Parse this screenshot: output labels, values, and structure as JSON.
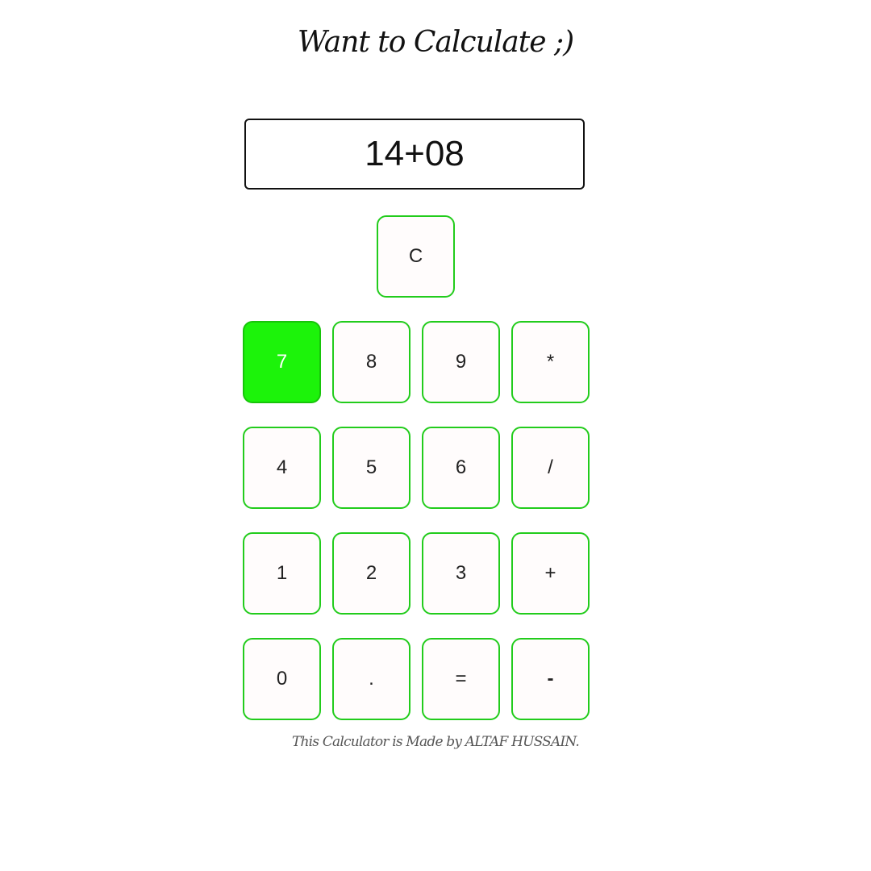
{
  "header": {
    "title": "Want to Calculate ;)"
  },
  "display": {
    "value": "14+08"
  },
  "keys": {
    "clear": "C",
    "row1": [
      "7",
      "8",
      "9",
      "*"
    ],
    "row2": [
      "4",
      "5",
      "6",
      "/"
    ],
    "row3": [
      "1",
      "2",
      "3",
      "+"
    ],
    "row4": [
      "0",
      ".",
      "=",
      "-"
    ]
  },
  "state": {
    "active_key": "7"
  },
  "colors": {
    "key_border": "#22cc1c",
    "key_active_bg": "#1cf30a",
    "display_border": "#111111"
  },
  "footer": {
    "credit": "This Calculator is Made by ALTAF HUSSAIN."
  }
}
